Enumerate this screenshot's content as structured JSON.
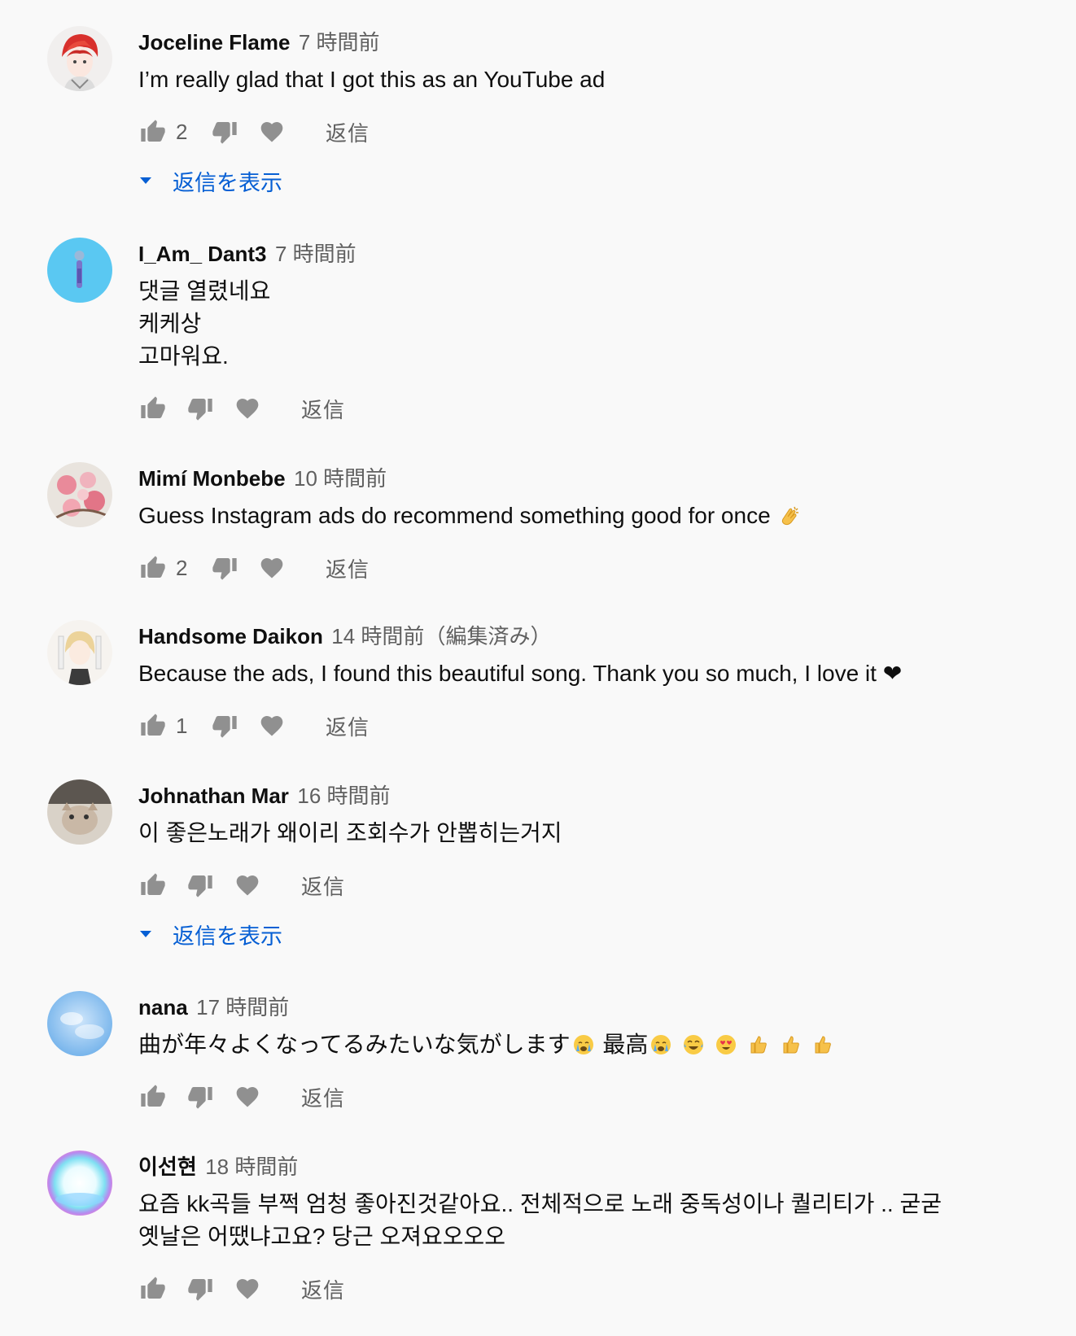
{
  "icons": {
    "like": "thumbs-up-icon",
    "dislike": "thumbs-down-icon",
    "heart": "heart-icon",
    "caret": "caret-down-icon"
  },
  "colors": {
    "background": "#f9f9f9",
    "link_blue": "#065fd4",
    "secondary_text": "#606060",
    "icon_gray": "#909090"
  },
  "comments": [
    {
      "author": "Joceline Flame",
      "time": "7 時間前",
      "edited": "",
      "lines": [
        "I’m really glad that I got this as an YouTube ad"
      ],
      "likes": "2",
      "reply_label": "返信",
      "show_replies_label": "返信を表示"
    },
    {
      "author": "I_Am_ Dant3",
      "time": "7 時間前",
      "edited": "",
      "lines": [
        "댓글 열렸네요",
        "케케상",
        "고마워요."
      ],
      "likes": "",
      "reply_label": "返信"
    },
    {
      "author": "Mimí Monbebe",
      "time": "10 時間前",
      "edited": "",
      "lines": [
        "Guess Instagram ads do recommend something good for once"
      ],
      "likes": "2",
      "reply_label": "返信"
    },
    {
      "author": "Handsome Daikon",
      "time": "14 時間前",
      "edited": "（編集済み）",
      "lines": [
        "Because the ads, I found this beautiful song. Thank you so much, I love it ❤"
      ],
      "likes": "1",
      "reply_label": "返信"
    },
    {
      "author": "Johnathan Mar",
      "time": "16 時間前",
      "edited": "",
      "lines": [
        "이 좋은노래가 왜이리 조회수가 안뽑히는거지"
      ],
      "likes": "",
      "reply_label": "返信",
      "show_replies_label": "返信を表示"
    },
    {
      "author": "nana",
      "time": "17 時間前",
      "edited": "",
      "lines": [
        "曲が年々よくなってるみたいな気がします",
        "最高"
      ],
      "likes": "",
      "reply_label": "返信"
    },
    {
      "author": "이선현",
      "time": "18 時間前",
      "edited": "",
      "lines": [
        "요즘 kk곡들 부쩍 엄청 좋아진것같아요.. 전체적으로 노래 중독성이나 퀄리티가 .. 굳굳",
        "옛날은 어땠냐고요? 당근 오져요오오오"
      ],
      "likes": "",
      "reply_label": "返信"
    }
  ]
}
